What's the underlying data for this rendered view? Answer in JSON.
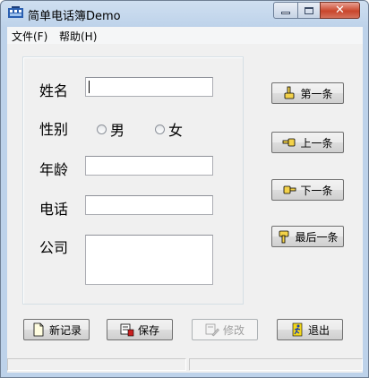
{
  "window": {
    "title": "简单电话簿Demo"
  },
  "menu": {
    "file": "文件(F)",
    "help": "帮助(H)"
  },
  "form": {
    "name_label": "姓名",
    "name_value": "",
    "gender_label": "性别",
    "gender_male": "男",
    "gender_female": "女",
    "age_label": "年龄",
    "age_value": "",
    "phone_label": "电话",
    "phone_value": "",
    "company_label": "公司",
    "company_value": ""
  },
  "nav": {
    "first": "第一条",
    "prev": "上一条",
    "next": "下一条",
    "last": "最后一条"
  },
  "actions": {
    "new": "新记录",
    "save": "保存",
    "edit": "修改",
    "exit": "退出"
  },
  "icons": {
    "first": "hand-point-up-icon",
    "prev": "hand-point-left-icon",
    "next": "hand-point-right-icon",
    "last": "hand-point-down-icon",
    "new": "new-document-icon",
    "save": "save-icon",
    "edit": "edit-icon",
    "exit": "exit-runner-icon"
  },
  "colors": {
    "window_frame": "#bdd2ea",
    "close_button": "#c9462c",
    "client_bg": "#f0f0f0"
  }
}
